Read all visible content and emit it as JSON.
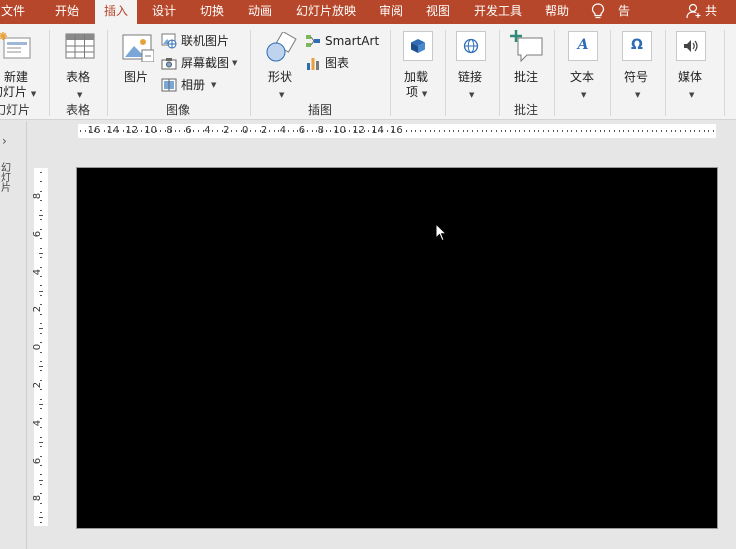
{
  "menubar": {
    "tabs": [
      "文件",
      "开始",
      "插入",
      "设计",
      "切换",
      "动画",
      "幻灯片放映",
      "审阅",
      "视图",
      "开发工具",
      "帮助"
    ],
    "active_tab": "插入",
    "tell_me": "告诉我",
    "share": "共享"
  },
  "ribbon": {
    "new_slide": {
      "label1": "新建",
      "label2": "幻灯片"
    },
    "table": "表格",
    "picture": "图片",
    "online_picture": "联机图片",
    "screenshot": "屏幕截图",
    "album": "相册",
    "shapes": "形状",
    "smartart": "SmartArt",
    "chart": "图表",
    "addins": {
      "label1": "加载",
      "label2": "项"
    },
    "links": "链接",
    "comment": "批注",
    "text": "文本",
    "symbols": "符号",
    "media": "媒体",
    "groups": {
      "slides": "幻灯片",
      "tables": "表格",
      "images": "图像",
      "illustrations": "插图",
      "comments": "批注"
    }
  },
  "ruler": {
    "horizontal": [
      "16",
      "14",
      "12",
      "10",
      "8",
      "6",
      "4",
      "2",
      "0",
      "2",
      "4",
      "6",
      "8",
      "10",
      "12",
      "14",
      "16"
    ],
    "vertical": [
      "8",
      "6",
      "4",
      "2",
      "0",
      "2",
      "4",
      "6",
      "8"
    ]
  },
  "pane": {
    "label": "幻灯片"
  },
  "colors": {
    "accent": "#b7472a",
    "ribbon_bg": "#f3f3f3",
    "canvas_bg": "#e6e6e6",
    "slide_bg": "#000000"
  }
}
